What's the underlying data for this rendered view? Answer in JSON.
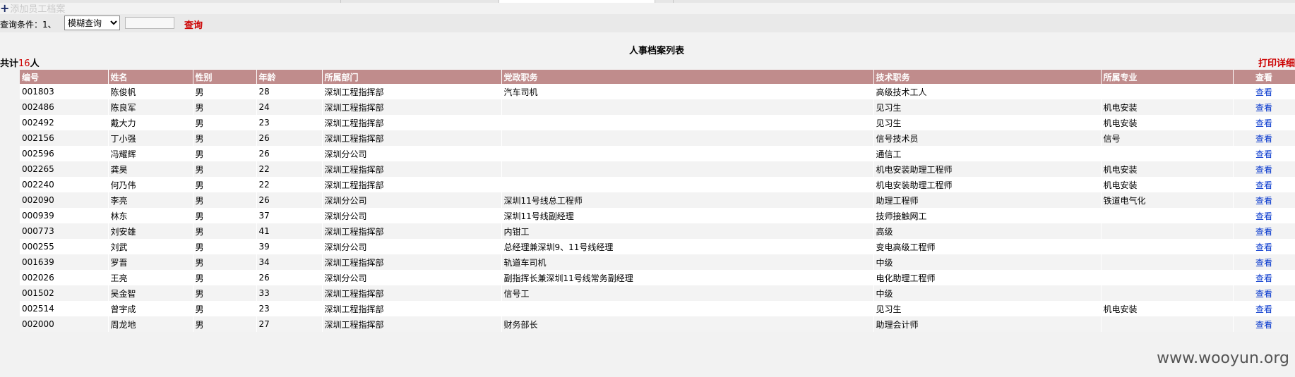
{
  "toolbar": {
    "add_label": "添加员工档案"
  },
  "query": {
    "label": "查询条件：1、",
    "mode_selected": "模糊查询",
    "input_value": "",
    "search_label": "查询"
  },
  "list": {
    "title": "人事档案列表",
    "count_prefix": "共计",
    "count": "16",
    "count_suffix": "人",
    "print_label": "打印详细"
  },
  "table": {
    "headers": [
      "编号",
      "姓名",
      "性别",
      "年龄",
      "所属部门",
      "党政职务",
      "技术职务",
      "所属专业",
      "查看"
    ],
    "rows": [
      [
        "001803",
        "陈俊帆",
        "男",
        "28",
        "深圳工程指挥部",
        "汽车司机",
        "高级技术工人",
        "",
        "查看"
      ],
      [
        "002486",
        "陈良军",
        "男",
        "24",
        "深圳工程指挥部",
        "",
        "见习生",
        "机电安装",
        "查看"
      ],
      [
        "002492",
        "戴大力",
        "男",
        "23",
        "深圳工程指挥部",
        "",
        "见习生",
        "机电安装",
        "查看"
      ],
      [
        "002156",
        "丁小强",
        "男",
        "26",
        "深圳工程指挥部",
        "",
        "信号技术员",
        "信号",
        "查看"
      ],
      [
        "002596",
        "冯耀辉",
        "男",
        "26",
        "深圳分公司",
        "",
        "通信工",
        "",
        "查看"
      ],
      [
        "002265",
        "龚昊",
        "男",
        "22",
        "深圳工程指挥部",
        "",
        "机电安装助理工程师",
        "机电安装",
        "查看"
      ],
      [
        "002240",
        "何乃伟",
        "男",
        "22",
        "深圳工程指挥部",
        "",
        "机电安装助理工程师",
        "机电安装",
        "查看"
      ],
      [
        "002090",
        "李亮",
        "男",
        "26",
        "深圳分公司",
        "深圳11号线总工程师",
        "助理工程师",
        "铁道电气化",
        "查看"
      ],
      [
        "000939",
        "林东",
        "男",
        "37",
        "深圳分公司",
        "深圳11号线副经理",
        "技师接触网工",
        "",
        "查看"
      ],
      [
        "000773",
        "刘安雄",
        "男",
        "41",
        "深圳工程指挥部",
        "内钳工",
        "高级",
        "",
        "查看"
      ],
      [
        "000255",
        "刘武",
        "男",
        "39",
        "深圳分公司",
        "总经理兼深圳9、11号线经理",
        "变电高级工程师",
        "",
        "查看"
      ],
      [
        "001639",
        "罗晋",
        "男",
        "34",
        "深圳工程指挥部",
        "轨道车司机",
        "中级",
        "",
        "查看"
      ],
      [
        "002026",
        "王亮",
        "男",
        "26",
        "深圳分公司",
        "副指挥长兼深圳11号线常务副经理",
        "电化助理工程师",
        "",
        "查看"
      ],
      [
        "001502",
        "吴金智",
        "男",
        "33",
        "深圳工程指挥部",
        "信号工",
        "中级",
        "",
        "查看"
      ],
      [
        "002514",
        "曾宇成",
        "男",
        "23",
        "深圳工程指挥部",
        "",
        "见习生",
        "机电安装",
        "查看"
      ],
      [
        "002000",
        "周龙地",
        "男",
        "27",
        "深圳工程指挥部",
        "财务部长",
        "助理会计师",
        "",
        "查看"
      ]
    ]
  },
  "watermark": "www.wooyun.org",
  "colors": {
    "header_bg": "#c08c8c",
    "accent_red": "#cc0000",
    "link_blue": "#0033cc"
  }
}
